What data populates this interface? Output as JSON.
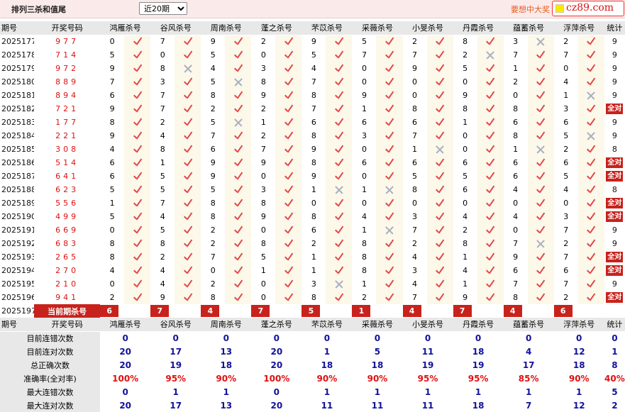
{
  "header": {
    "title": "排列三杀和值尾",
    "period_select": {
      "selected": "近20期"
    },
    "promo_text": "要想中大奖",
    "logo_text": "cz89.com"
  },
  "columns": {
    "issue": "期号",
    "draw": "开奖号码",
    "experts": [
      "鸿雁杀号",
      "谷风杀号",
      "周南杀号",
      "蓬之杀号",
      "芣苡杀号",
      "采薇杀号",
      "小旻杀号",
      "丹霞杀号",
      "蕴蓄杀号",
      "浮萍杀号"
    ],
    "stats": "统计"
  },
  "rows": [
    {
      "issue": "2025177",
      "draw": "977",
      "picks": [
        0,
        7,
        9,
        2,
        9,
        5,
        2,
        8,
        3,
        2
      ],
      "hits": [
        1,
        1,
        1,
        1,
        1,
        1,
        1,
        1,
        0,
        1
      ],
      "stat": "9"
    },
    {
      "issue": "2025178",
      "draw": "714",
      "picks": [
        5,
        0,
        5,
        0,
        5,
        7,
        7,
        2,
        7,
        7
      ],
      "hits": [
        1,
        1,
        1,
        1,
        1,
        1,
        1,
        0,
        1,
        1
      ],
      "stat": "9"
    },
    {
      "issue": "2025179",
      "draw": "972",
      "picks": [
        9,
        8,
        4,
        3,
        4,
        0,
        9,
        5,
        1,
        0
      ],
      "hits": [
        1,
        0,
        1,
        1,
        1,
        1,
        1,
        1,
        1,
        1
      ],
      "stat": "9"
    },
    {
      "issue": "2025180",
      "draw": "889",
      "picks": [
        7,
        3,
        5,
        8,
        7,
        0,
        0,
        0,
        2,
        4
      ],
      "hits": [
        1,
        1,
        0,
        1,
        1,
        1,
        1,
        1,
        1,
        1
      ],
      "stat": "9"
    },
    {
      "issue": "2025181",
      "draw": "894",
      "picks": [
        6,
        7,
        8,
        9,
        8,
        9,
        0,
        9,
        0,
        1
      ],
      "hits": [
        1,
        1,
        1,
        1,
        1,
        1,
        1,
        1,
        1,
        0
      ],
      "stat": "9"
    },
    {
      "issue": "2025182",
      "draw": "721",
      "picks": [
        9,
        7,
        2,
        2,
        7,
        1,
        8,
        8,
        8,
        3
      ],
      "hits": [
        1,
        1,
        1,
        1,
        1,
        1,
        1,
        1,
        1,
        1
      ],
      "stat": "全对"
    },
    {
      "issue": "2025183",
      "draw": "177",
      "picks": [
        8,
        2,
        5,
        1,
        6,
        6,
        6,
        1,
        6,
        6
      ],
      "hits": [
        1,
        1,
        0,
        1,
        1,
        1,
        1,
        1,
        1,
        1
      ],
      "stat": "9"
    },
    {
      "issue": "2025184",
      "draw": "221",
      "picks": [
        9,
        4,
        7,
        2,
        8,
        3,
        7,
        0,
        8,
        5
      ],
      "hits": [
        1,
        1,
        1,
        1,
        1,
        1,
        1,
        1,
        1,
        0
      ],
      "stat": "9"
    },
    {
      "issue": "2025185",
      "draw": "308",
      "picks": [
        4,
        8,
        6,
        7,
        9,
        0,
        1,
        0,
        1,
        2
      ],
      "hits": [
        1,
        1,
        1,
        1,
        1,
        1,
        0,
        1,
        0,
        1
      ],
      "stat": "8"
    },
    {
      "issue": "2025186",
      "draw": "514",
      "picks": [
        6,
        1,
        9,
        9,
        8,
        6,
        6,
        6,
        6,
        6
      ],
      "hits": [
        1,
        1,
        1,
        1,
        1,
        1,
        1,
        1,
        1,
        1
      ],
      "stat": "全对"
    },
    {
      "issue": "2025187",
      "draw": "641",
      "picks": [
        6,
        5,
        9,
        0,
        9,
        0,
        5,
        5,
        6,
        5
      ],
      "hits": [
        1,
        1,
        1,
        1,
        1,
        1,
        1,
        1,
        1,
        1
      ],
      "stat": "全对"
    },
    {
      "issue": "2025188",
      "draw": "623",
      "picks": [
        5,
        5,
        5,
        3,
        1,
        1,
        8,
        6,
        4,
        4
      ],
      "hits": [
        1,
        1,
        1,
        1,
        0,
        0,
        1,
        1,
        1,
        1
      ],
      "stat": "8"
    },
    {
      "issue": "2025189",
      "draw": "556",
      "picks": [
        1,
        7,
        8,
        8,
        0,
        0,
        0,
        0,
        0,
        0
      ],
      "hits": [
        1,
        1,
        1,
        1,
        1,
        1,
        1,
        1,
        1,
        1
      ],
      "stat": "全对"
    },
    {
      "issue": "2025190",
      "draw": "499",
      "picks": [
        5,
        4,
        8,
        9,
        8,
        4,
        3,
        4,
        4,
        3
      ],
      "hits": [
        1,
        1,
        1,
        1,
        1,
        1,
        1,
        1,
        1,
        1
      ],
      "stat": "全对"
    },
    {
      "issue": "2025191",
      "draw": "669",
      "picks": [
        0,
        5,
        2,
        0,
        6,
        1,
        7,
        2,
        0,
        7
      ],
      "hits": [
        1,
        1,
        1,
        1,
        1,
        0,
        1,
        1,
        1,
        1
      ],
      "stat": "9"
    },
    {
      "issue": "2025192",
      "draw": "683",
      "picks": [
        8,
        8,
        2,
        8,
        2,
        8,
        2,
        8,
        7,
        2
      ],
      "hits": [
        1,
        1,
        1,
        1,
        1,
        1,
        1,
        1,
        0,
        1
      ],
      "stat": "9"
    },
    {
      "issue": "2025193",
      "draw": "265",
      "picks": [
        8,
        2,
        7,
        5,
        1,
        8,
        4,
        1,
        9,
        7
      ],
      "hits": [
        1,
        1,
        1,
        1,
        1,
        1,
        1,
        1,
        1,
        1
      ],
      "stat": "全对"
    },
    {
      "issue": "2025194",
      "draw": "270",
      "picks": [
        4,
        4,
        0,
        1,
        1,
        8,
        3,
        4,
        6,
        6
      ],
      "hits": [
        1,
        1,
        1,
        1,
        1,
        1,
        1,
        1,
        1,
        1
      ],
      "stat": "全对"
    },
    {
      "issue": "2025195",
      "draw": "210",
      "picks": [
        0,
        4,
        2,
        0,
        3,
        1,
        4,
        1,
        7,
        7
      ],
      "hits": [
        1,
        1,
        1,
        1,
        0,
        1,
        1,
        1,
        1,
        1
      ],
      "stat": "9"
    },
    {
      "issue": "2025196",
      "draw": "941",
      "picks": [
        2,
        9,
        8,
        0,
        8,
        2,
        7,
        9,
        8,
        2
      ],
      "hits": [
        1,
        1,
        1,
        1,
        1,
        1,
        1,
        1,
        1,
        1
      ],
      "stat": "全对"
    }
  ],
  "current": {
    "issue": "2025197",
    "label": "当前期杀号",
    "picks": [
      "6",
      "7",
      "4",
      "7",
      "5",
      "1",
      "4",
      "7",
      "4",
      "6"
    ]
  },
  "stats": [
    {
      "label": "目前连错次数",
      "values": [
        "0",
        "0",
        "0",
        "0",
        "0",
        "0",
        "0",
        "0",
        "0",
        "0"
      ],
      "total": "0",
      "red": false
    },
    {
      "label": "目前连对次数",
      "values": [
        "20",
        "17",
        "13",
        "20",
        "1",
        "5",
        "11",
        "18",
        "4",
        "12"
      ],
      "total": "1",
      "red": false
    },
    {
      "label": "总正确次数",
      "values": [
        "20",
        "19",
        "18",
        "20",
        "18",
        "18",
        "19",
        "19",
        "17",
        "18"
      ],
      "total": "8",
      "red": false
    },
    {
      "label": "准确率(全对率)",
      "values": [
        "100%",
        "95%",
        "90%",
        "100%",
        "90%",
        "90%",
        "95%",
        "95%",
        "85%",
        "90%"
      ],
      "total": "40%",
      "red": true
    },
    {
      "label": "最大连错次数",
      "values": [
        "0",
        "1",
        "1",
        "0",
        "1",
        "1",
        "1",
        "1",
        "1",
        "1"
      ],
      "total": "5",
      "red": false
    },
    {
      "label": "最大连对次数",
      "values": [
        "20",
        "17",
        "13",
        "20",
        "11",
        "11",
        "11",
        "18",
        "7",
        "12"
      ],
      "total": "2",
      "red": false
    }
  ],
  "colors": {
    "accent_red": "#c8221c",
    "check": "#e04848",
    "stat_blue": "#12129a",
    "header_bg": "#e8e8e8",
    "mark_bg": "#fcf8ea"
  }
}
